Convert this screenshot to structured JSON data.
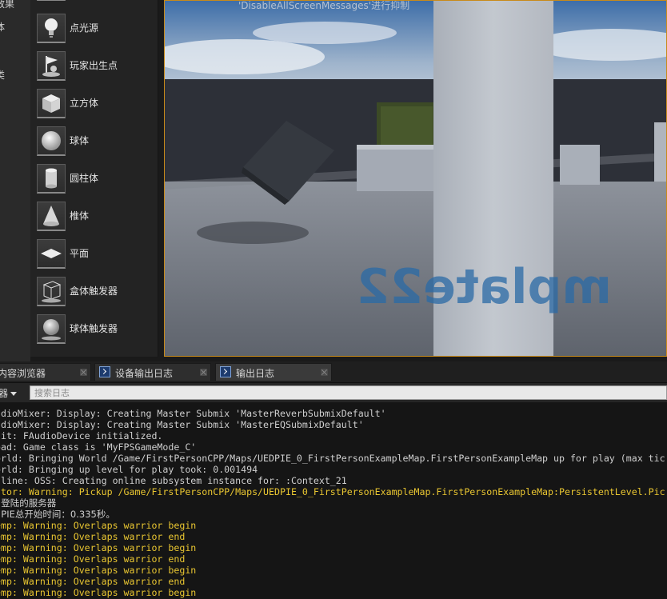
{
  "left_categories": [
    "效果",
    "体",
    "类"
  ],
  "place_items": [
    {
      "label": "点光源",
      "icon": "point-light-icon"
    },
    {
      "label": "玩家出生点",
      "icon": "player-start-icon"
    },
    {
      "label": "立方体",
      "icon": "cube-icon"
    },
    {
      "label": "球体",
      "icon": "sphere-icon"
    },
    {
      "label": "圆柱体",
      "icon": "cylinder-icon"
    },
    {
      "label": "椎体",
      "icon": "cone-icon"
    },
    {
      "label": "平面",
      "icon": "plane-icon"
    },
    {
      "label": "盒体触发器",
      "icon": "box-trigger-icon"
    },
    {
      "label": "球体触发器",
      "icon": "sphere-trigger-icon"
    }
  ],
  "viewport": {
    "message": "'DisableAllScreenMessages'进行抑制",
    "floor_text": "mplate22"
  },
  "tabs": [
    {
      "label": "内容浏览器",
      "icon": null
    },
    {
      "label": "设备输出日志",
      "icon": "console-icon"
    },
    {
      "label": "输出日志",
      "icon": "console-icon"
    }
  ],
  "filter": {
    "label": "器",
    "search_placeholder": "搜索日志"
  },
  "log_lines": [
    {
      "text": "udioMixer: Display: Creating Master Submix 'MasterReverbSubmixDefault'",
      "level": "normal"
    },
    {
      "text": "udioMixer: Display: Creating Master Submix 'MasterEQSubmixDefault'",
      "level": "normal"
    },
    {
      "text": "nit: FAudioDevice initialized.",
      "level": "normal"
    },
    {
      "text": "oad: Game class is 'MyFPSGameMode_C'",
      "level": "normal"
    },
    {
      "text": "orld: Bringing World /Game/FirstPersonCPP/Maps/UEDPIE_0_FirstPersonExampleMap.FirstPersonExampleMap up for play (max tic",
      "level": "normal"
    },
    {
      "text": "orld: Bringing up level for play took: 0.001494",
      "level": "normal"
    },
    {
      "text": "nline: OSS: Creating online subsystem instance for: :Context_21",
      "level": "normal"
    },
    {
      "text": "ctor: Warning: Pickup /Game/FirstPersonCPP/Maps/UEDPIE_0_FirstPersonExampleMap.FirstPersonExampleMap:PersistentLevel.Pic",
      "level": "warning"
    },
    {
      "text": "  登陆的服务器",
      "level": "normal"
    },
    {
      "text": "  PIE总开始时间：0.335秒。",
      "level": "normal"
    },
    {
      "text": "emp: Warning: Overlaps warrior begin",
      "level": "warning"
    },
    {
      "text": "emp: Warning: Overlaps warrior end",
      "level": "warning"
    },
    {
      "text": "emp: Warning: Overlaps warrior begin",
      "level": "warning"
    },
    {
      "text": "emp: Warning: Overlaps warrior end",
      "level": "warning"
    },
    {
      "text": "emp: Warning: Overlaps warrior begin",
      "level": "warning"
    },
    {
      "text": "emp: Warning: Overlaps warrior end",
      "level": "warning"
    },
    {
      "text": "emp: Warning: Overlaps warrior begin",
      "level": "warning"
    }
  ],
  "colors": {
    "warning": "#e9c631",
    "viewport_border": "#c88a1a",
    "sky": "#7b92ad"
  }
}
